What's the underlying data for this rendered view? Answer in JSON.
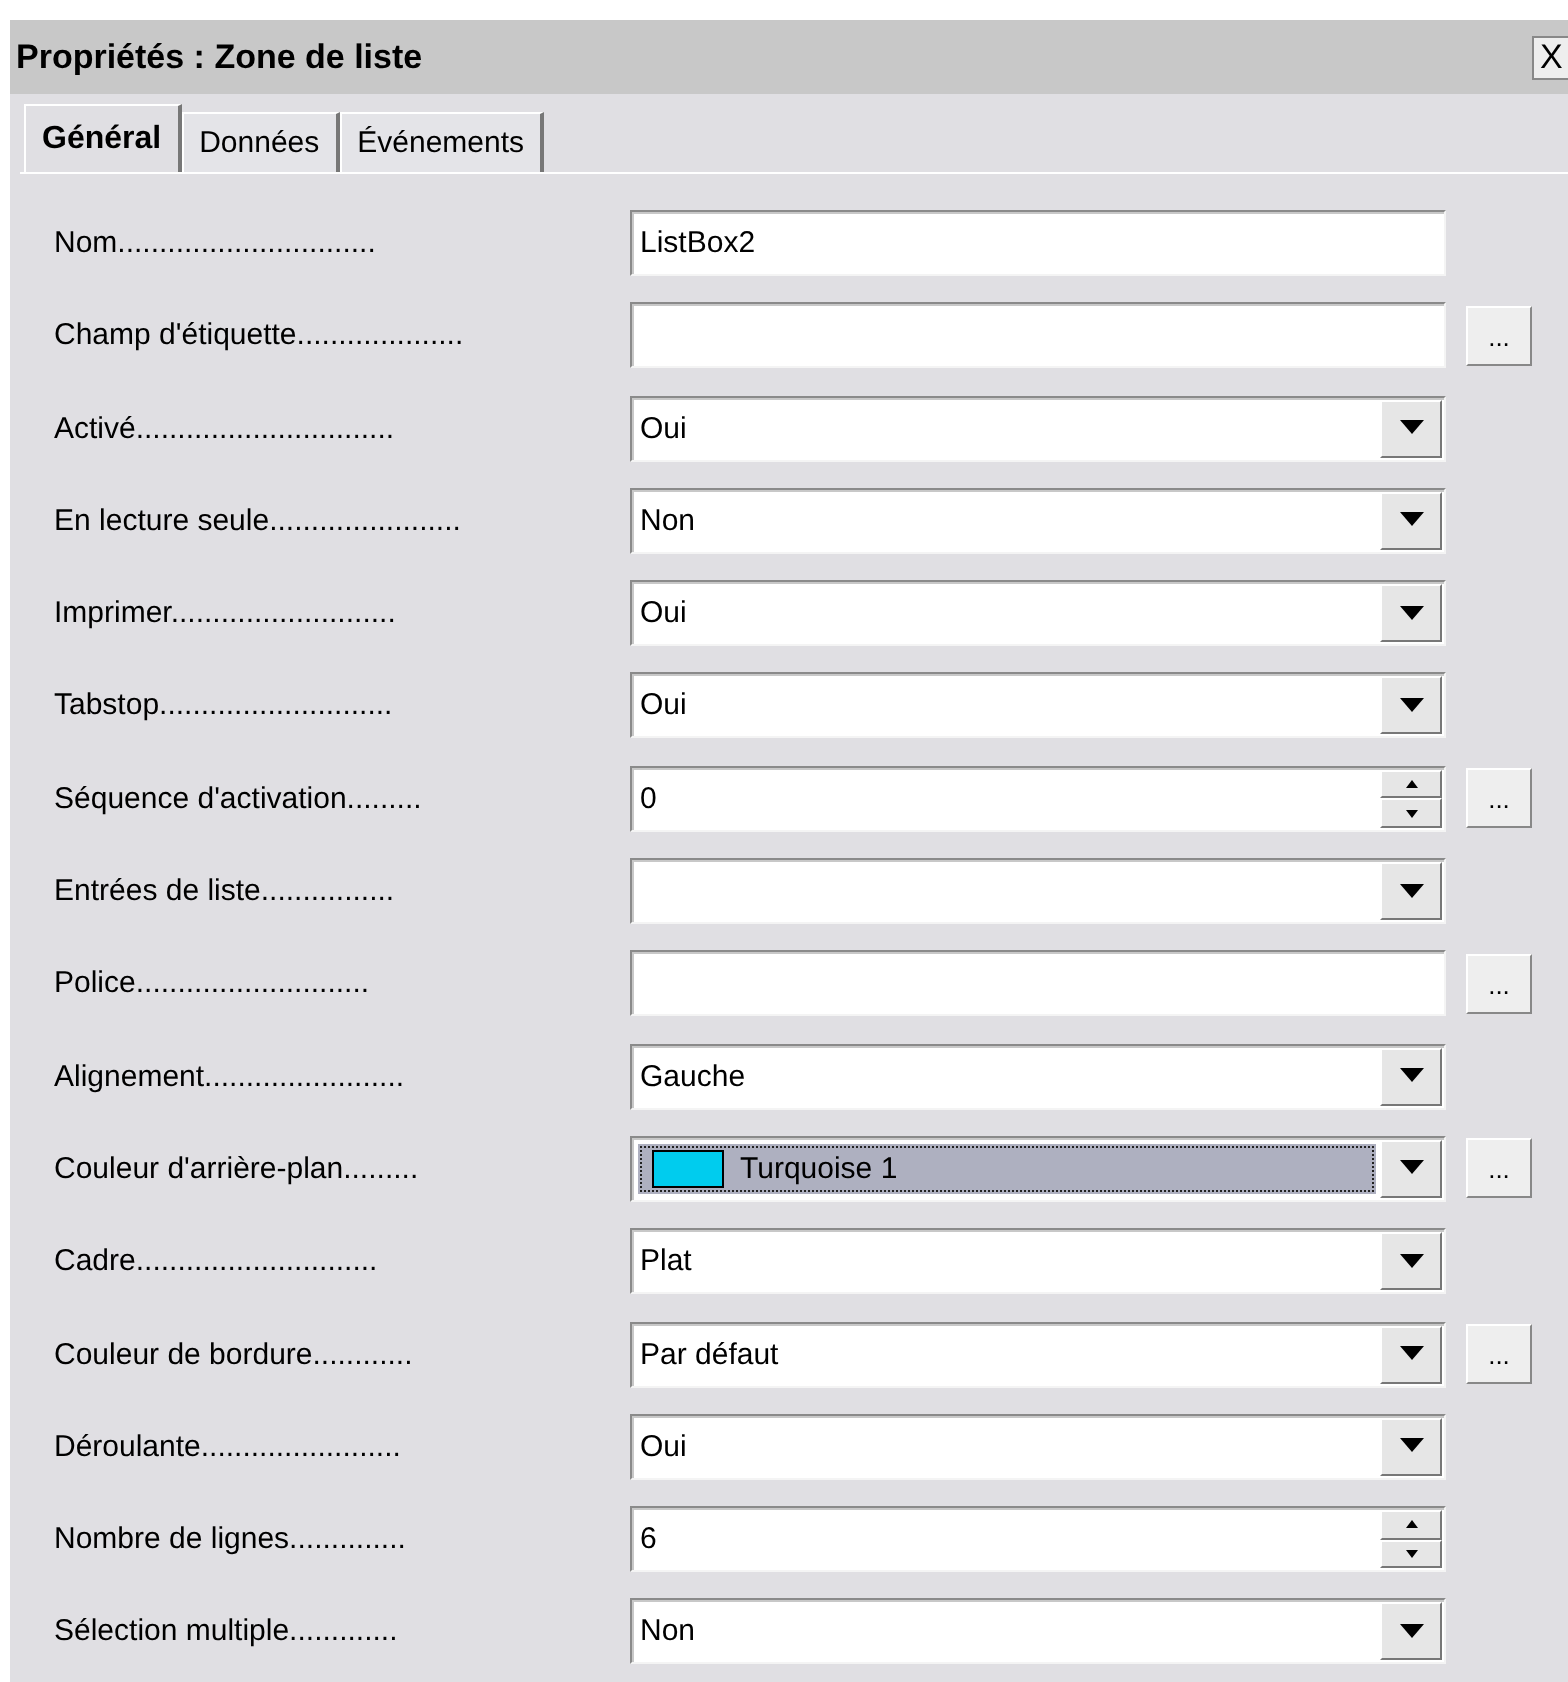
{
  "window": {
    "title": "Propriétés : Zone de liste",
    "close": "X"
  },
  "tabs": [
    {
      "label": "Général",
      "selected": true
    },
    {
      "label": "Données",
      "selected": false
    },
    {
      "label": "Événements",
      "selected": false
    }
  ],
  "rows": [
    {
      "label": "Nom...............................",
      "kind": "text",
      "value": "ListBox2",
      "focused": false
    },
    {
      "label": "Champ d'étiquette....................",
      "kind": "text",
      "focused": false,
      "button": "..."
    },
    {
      "label": "Activé...............................",
      "kind": "combo",
      "value": "Oui",
      "focused": false
    },
    {
      "label": "En lecture seule.......................",
      "kind": "combo",
      "value": "Non",
      "focused": false
    },
    {
      "label": "Imprimer...........................",
      "kind": "combo",
      "value": "Oui",
      "focused": false
    },
    {
      "label": "Tabstop............................",
      "kind": "combo",
      "value": "Oui",
      "focused": false
    },
    {
      "label": "Séquence d'activation.........",
      "kind": "spin",
      "value": "0",
      "focused": false,
      "button": "..."
    },
    {
      "label": "Entrées de liste................",
      "kind": "combo",
      "focused": false
    },
    {
      "label": "Police............................",
      "kind": "text",
      "focused": false,
      "button": "..."
    },
    {
      "label": "Alignement........................",
      "kind": "combo",
      "value": "Gauche",
      "focused": false
    },
    {
      "label": "Couleur d'arrière-plan.........",
      "kind": "color",
      "value": "Turquoise 1",
      "color": "#00ccee",
      "focused": true,
      "button": "..."
    },
    {
      "label": "Cadre.............................",
      "kind": "combo",
      "value": "Plat",
      "focused": false
    },
    {
      "label": "Couleur de bordure............",
      "kind": "combo",
      "value": "Par défaut",
      "focused": false,
      "button": "..."
    },
    {
      "label": "Déroulante........................",
      "kind": "combo",
      "value": "Oui",
      "focused": false
    },
    {
      "label": "Nombre de lignes..............",
      "kind": "spin",
      "value": "6",
      "focused": false
    },
    {
      "label": "Sélection multiple.............",
      "kind": "combo",
      "value": "Non",
      "focused": false
    }
  ]
}
